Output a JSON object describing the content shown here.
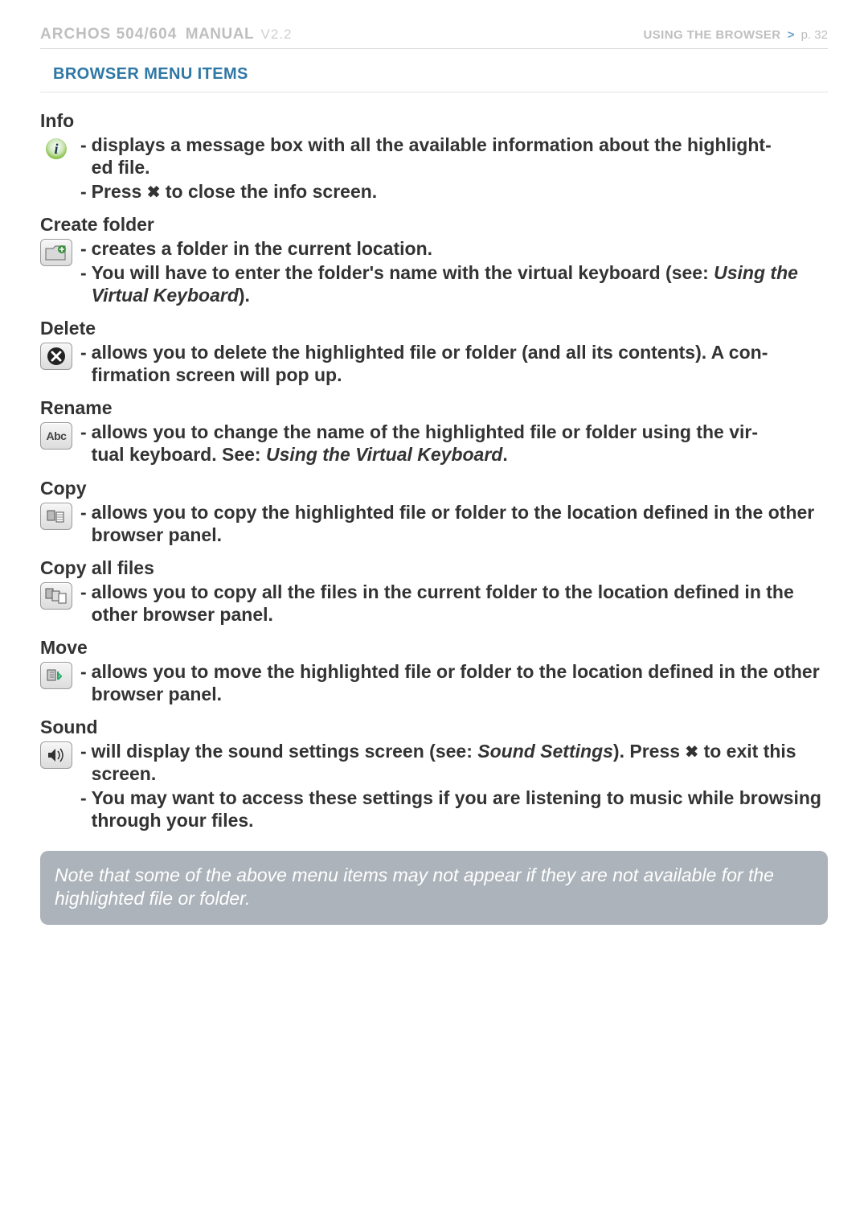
{
  "header": {
    "brand": "ARCHOS 504/604",
    "manual": "MANUAL",
    "version": "V2.2",
    "crumb_using": "USING THE BROWSER",
    "crumb_sep": ">",
    "crumb_page": "p. 32"
  },
  "section_title": "BROWSER MENU ITEMS",
  "items": {
    "info": {
      "title": "Info",
      "b1a": "displays a message box with all the available information about the highlight",
      "b1b": "ed file.",
      "b2a": "Press ",
      "b2b": " to close the info screen."
    },
    "create_folder": {
      "title": "Create folder",
      "b1": "creates a folder in the current location.",
      "b2a": "You will have to enter the folder's name with the virtual keyboard (see: ",
      "b2b": "Using the Virtual Keyboard",
      "b2c": ")."
    },
    "delete": {
      "title": "Delete",
      "b1a": "allows you to delete the highlighted file or folder (and all its contents). A con",
      "b1b": "firmation screen will pop up."
    },
    "rename": {
      "title": "Rename",
      "b1a": "allows you to change the name of the highlighted file or folder using the vir",
      "b1b": "tual keyboard. See: ",
      "b1c": "Using the Virtual Keyboard",
      "b1d": "."
    },
    "copy": {
      "title": "Copy",
      "b1": "allows you to copy the highlighted file or folder to the location defined in the other browser panel."
    },
    "copy_all": {
      "title": "Copy all files",
      "b1": "allows you to copy all the files in the current folder to the location defined in the other browser panel."
    },
    "move": {
      "title": "Move",
      "b1": "allows you to move the highlighted file or folder to the location defined in the other browser panel."
    },
    "sound": {
      "title": "Sound",
      "b1a": "will display the sound settings screen (see: ",
      "b1b": "Sound Settings",
      "b1c": "). Press ",
      "b1d": " to exit this screen.",
      "b2": "You may want to access these settings if you are listening to music while browsing through your files."
    }
  },
  "note": "Note that some of the above menu items may not appear if they are not available for the highlighted file or folder."
}
